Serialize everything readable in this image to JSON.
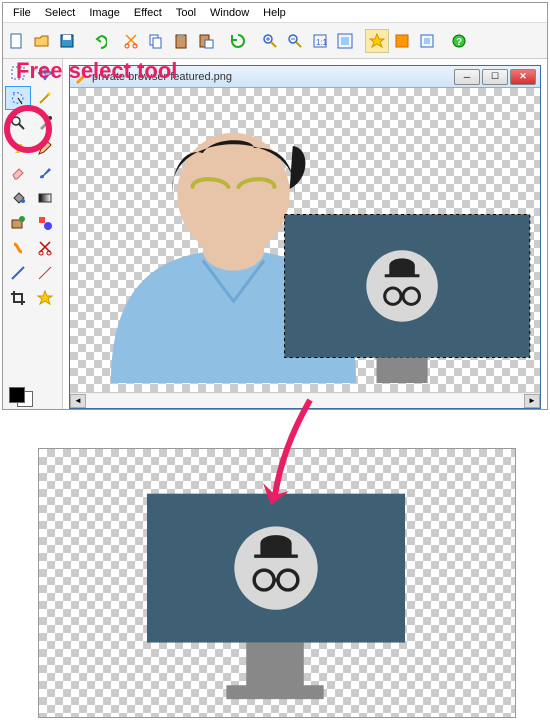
{
  "menu": {
    "file": "File",
    "select": "Select",
    "image": "Image",
    "effect": "Effect",
    "tool": "Tool",
    "window": "Window",
    "help": "Help"
  },
  "annotation_label": "Free select tool",
  "document": {
    "title": "private browser featured.png"
  },
  "toolbar_icons": [
    "new",
    "open",
    "save",
    "sep",
    "undo",
    "redo",
    "sep",
    "cut",
    "copy",
    "paste",
    "paste-new",
    "sep",
    "zoom-in",
    "zoom-out",
    "zoom-actual",
    "zoom-fit",
    "sep",
    "star",
    "layer",
    "window",
    "help"
  ],
  "tools": [
    "rect-select",
    "move",
    "free-select",
    "magic-wand",
    "zoom",
    "picker",
    "text",
    "pencil",
    "eraser",
    "brush",
    "paint-bucket",
    "clone",
    "gradient",
    "smudge",
    "shape",
    "line",
    "crop",
    "star-shape"
  ],
  "active_tool": "free-select",
  "colors": {
    "fg": "#000000",
    "bg": "#ffffff"
  }
}
